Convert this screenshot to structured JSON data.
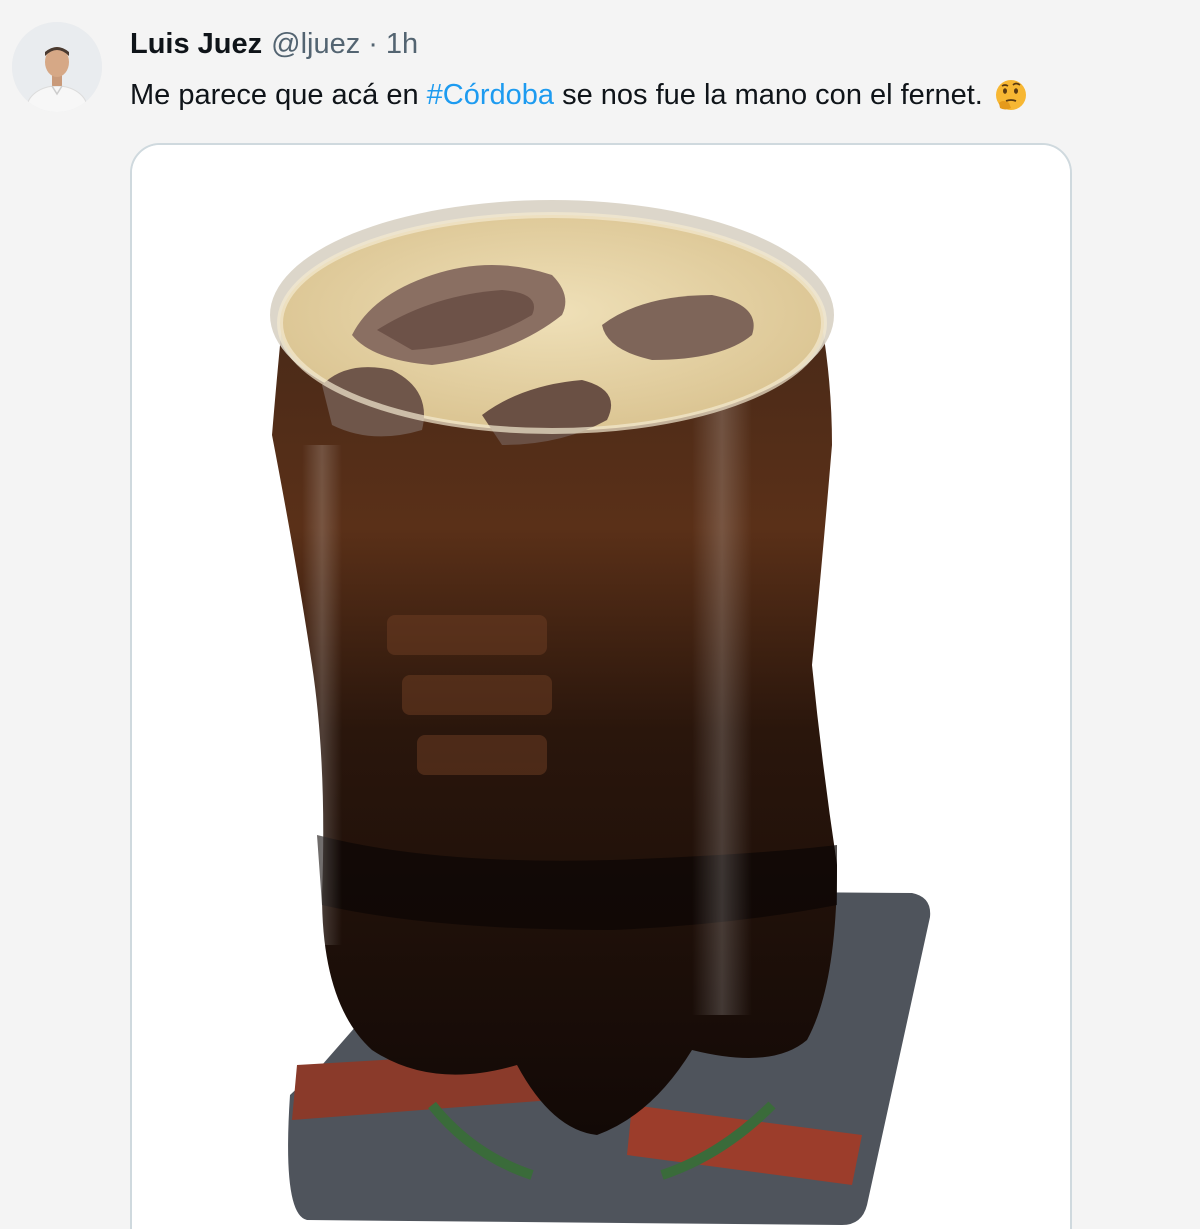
{
  "author": {
    "name": "Luis Juez",
    "handle": "@ljuez",
    "separator": "·",
    "time": "1h",
    "avatar_icon": "profile-photo"
  },
  "tweet": {
    "text_before": "Me parece que acá en ",
    "hashtag": "#Córdoba",
    "text_after": " se nos fue la mano con el fernet.",
    "emoji_icon": "thinking-face-emoji"
  },
  "media": {
    "icon": "fernet-glass-photo"
  },
  "colors": {
    "hashtag": "#1d9bf0",
    "text": "#0f1419",
    "secondary": "#536471",
    "background": "#f4f4f4"
  }
}
